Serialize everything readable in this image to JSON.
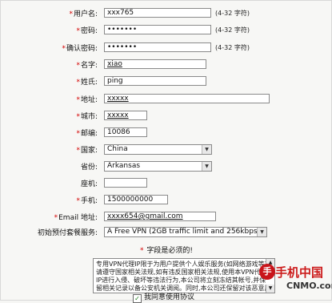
{
  "required_marker": "*",
  "fields": {
    "username": {
      "label": "用户名:",
      "value": "xxx765",
      "hint": "(4-32 字符)"
    },
    "password": {
      "label": "密码:",
      "value": "•••••••",
      "hint": "(4-32 字符)"
    },
    "confirm_password": {
      "label": "确认密码:",
      "value": "•••••••",
      "hint": "(4-32 字符)"
    },
    "first_name": {
      "label": "名字:",
      "value": "xiao"
    },
    "last_name": {
      "label": "姓氏:",
      "value": "ping"
    },
    "address": {
      "label": "地址:",
      "value": "xxxxx"
    },
    "city": {
      "label": "城市:",
      "value": "xxxxx"
    },
    "zip": {
      "label": "邮编:",
      "value": "10086"
    },
    "country": {
      "label": "国家:",
      "value": "China"
    },
    "province": {
      "label": "省份:",
      "value": "Arkansas"
    },
    "phone": {
      "label": "座机:",
      "value": ""
    },
    "mobile": {
      "label": "手机:",
      "value": "1500000000"
    },
    "email": {
      "label": "Email 地址:",
      "value": "xxxx654@gmail.com"
    },
    "plan": {
      "label": "初始预付套餐服务:",
      "value": "A Free VPN (2GB traffic limit and 256kbps)"
    }
  },
  "required_note": "字段是必须的!",
  "terms_text": "专用VPN代理IP限于为用户提供个人娱乐服务(如网络游戏等),请遵守国家相关法规,如有违反国家相关法规,使用本VPN代理IP进行入侵、破坏等违法行为,本公司将立刻冻结其帐号,并保留相关记录以备公安机关调阅。同时,本公司还保留对该恶意用户起诉的权利。为保证客户能正常使用网络游戏连接通道(以下简称代理),根据",
  "agree_label": "我同意使用协议",
  "agree_checked": "✓",
  "watermark": {
    "logo": "手",
    "cn": "手机中国",
    "en": "CNMO.com"
  }
}
